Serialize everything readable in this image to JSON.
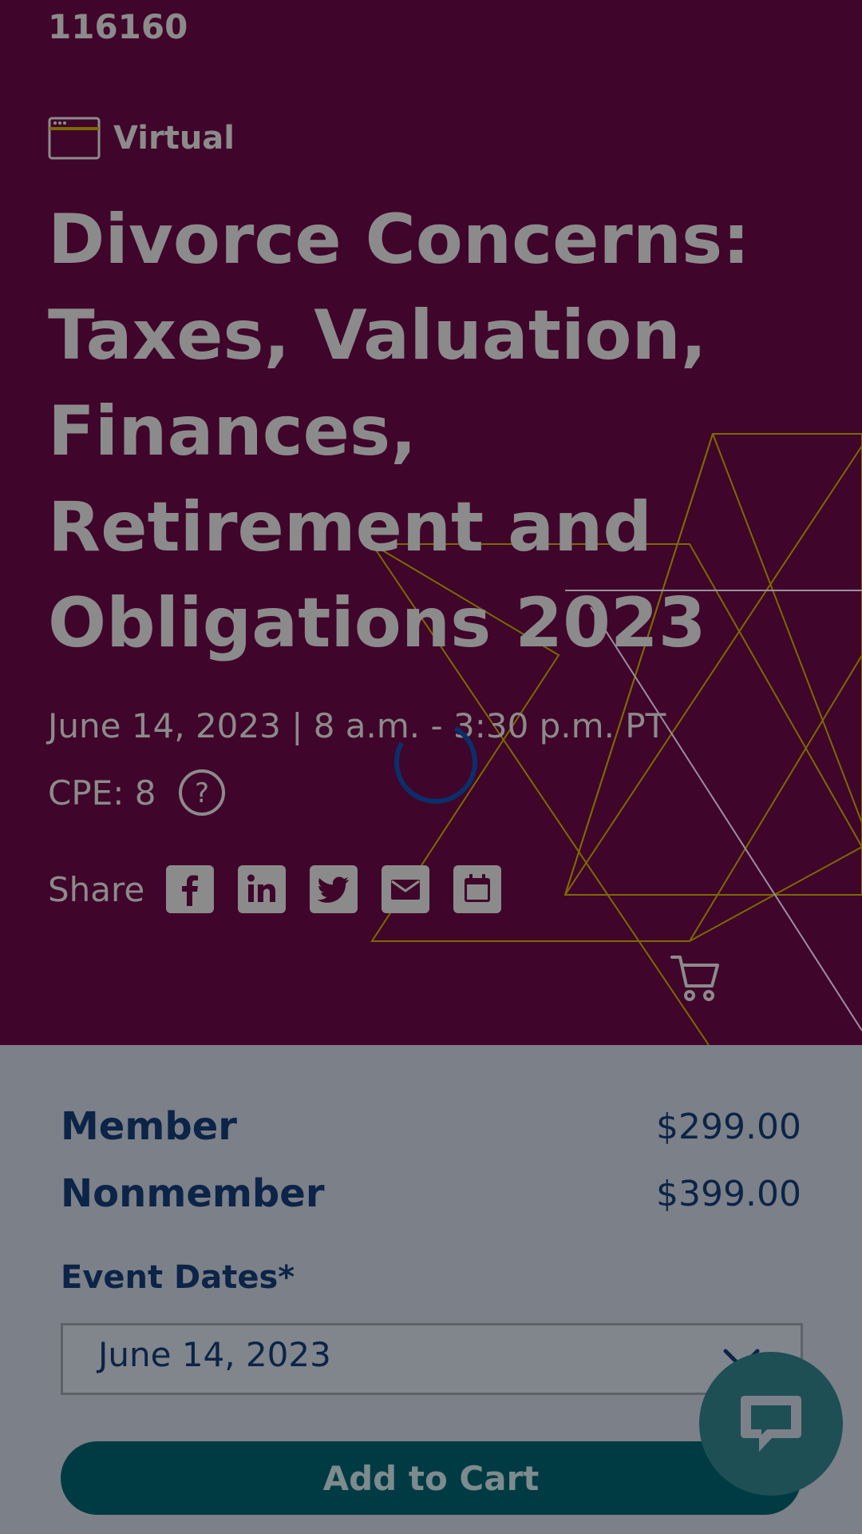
{
  "course": {
    "id": "116160",
    "format_label": "Virtual",
    "title": "Divorce Concerns: Taxes, Valuation, Finances, Retirement and Obligations 2023",
    "datetime": "June 14, 2023 | 8 a.m. - 3:30 p.m. PT",
    "cpe": "CPE: 8"
  },
  "share": {
    "label": "Share",
    "buttons": [
      "facebook-icon",
      "linkedin-icon",
      "twitter-icon",
      "email-icon",
      "calendar-icon"
    ]
  },
  "pricing": {
    "member_label": "Member",
    "member_price": "$299.00",
    "nonmember_label": "Nonmember",
    "nonmember_price": "$399.00"
  },
  "event_dates": {
    "label": "Event Dates*",
    "selected": "June 14, 2023"
  },
  "actions": {
    "add_to_cart": "Add to Cart"
  },
  "colors": {
    "hero_bg": "#40052a",
    "panel_bg": "#7c8088",
    "text_navy": "#0b2447",
    "button_teal": "#003b44",
    "accent_gold": "#7c6a00",
    "spinner": "#0b2f6a"
  }
}
